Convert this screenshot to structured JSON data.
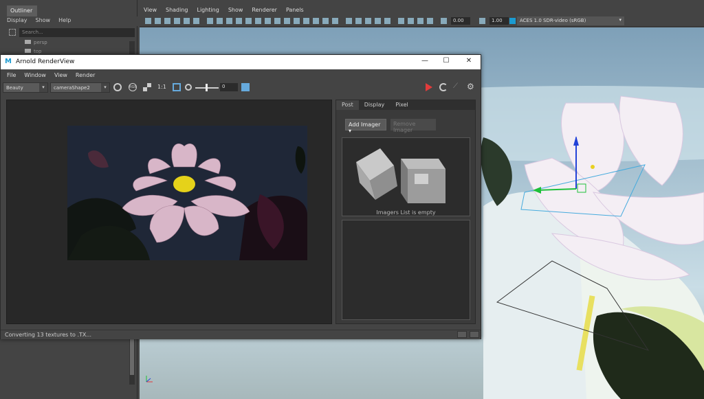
{
  "outliner": {
    "tab_label": "Outliner",
    "menu": [
      "Display",
      "Show",
      "Help"
    ],
    "search_placeholder": "Search...",
    "items": [
      "persp",
      "top"
    ]
  },
  "viewport": {
    "menu": [
      "View",
      "Shading",
      "Lighting",
      "Show",
      "Renderer",
      "Panels"
    ],
    "exposure": "0.00",
    "gamma": "1.00",
    "color_space": "ACES 1.0 SDR-video (sRGB)"
  },
  "renderview": {
    "title": "Arnold RenderView",
    "menu": [
      "File",
      "Window",
      "View",
      "Render"
    ],
    "aov": "Beauty",
    "camera": "cameraShape2",
    "ratio": "1:1",
    "exposure_value": "0",
    "side_tabs": [
      "Post",
      "Display",
      "Pixel"
    ],
    "add_imager": "Add Imager",
    "remove_imager": "Remove Imager",
    "imagers_empty": "Imagers List is empty",
    "status": "Converting 13 textures to .TX...",
    "colors": {
      "stop": "#e23b3b",
      "title_bg": "#ffffff",
      "panel": "#444444"
    }
  }
}
